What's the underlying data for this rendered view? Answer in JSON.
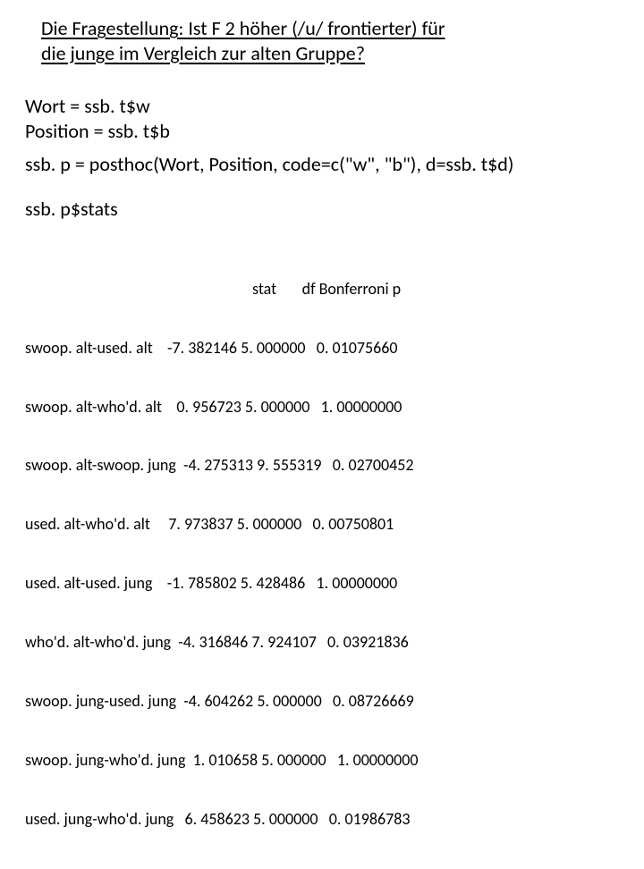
{
  "title": {
    "line1": "Die Fragestellung:  Ist F 2 höher (/u/ frontierter) für",
    "line2": "die junge im Vergleich zur alten Gruppe?"
  },
  "code": {
    "line1": "Wort = ssb. t$w",
    "line2": "Position = ssb. t$b",
    "line3": "ssb. p = posthoc(Wort, Position, code=c(\"w\", \"b\"), d=ssb. t$d)",
    "line4": "ssb. p$stats"
  },
  "stats": {
    "header": "stat       df Bonferroni p",
    "rows": [
      "swoop. alt-used. alt    -7. 382146 5. 000000   0. 01075660",
      "swoop. alt-who'd. alt    0. 956723 5. 000000   1. 00000000",
      "swoop. alt-swoop. jung  -4. 275313 9. 555319   0. 02700452",
      "used. alt-who'd. alt     7. 973837 5. 000000   0. 00750801",
      "used. alt-used. jung    -1. 785802 5. 428486   1. 00000000",
      "who'd. alt-who'd. jung  -4. 316846 7. 924107   0. 03921836",
      "swoop. jung-used. jung  -4. 604262 5. 000000   0. 08726669",
      "swoop. jung-who'd. jung  1. 010658 5. 000000   1. 00000000",
      "used. jung-who'd. jung   6. 458623 5. 000000   0. 01986783"
    ]
  }
}
